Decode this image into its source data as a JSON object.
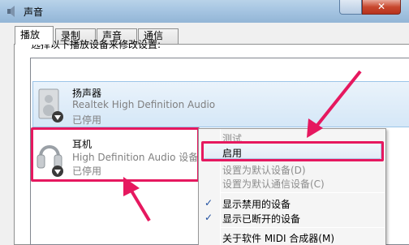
{
  "window": {
    "title": "声音",
    "close_glyph": "✕"
  },
  "tabs": [
    {
      "label": "播放",
      "active": true
    },
    {
      "label": "录制",
      "active": false
    },
    {
      "label": "声音",
      "active": false
    },
    {
      "label": "通信",
      "active": false
    }
  ],
  "instruction": "选择以下播放设备来修改设置:",
  "devices": [
    {
      "name": "扬声器",
      "description": "Realtek High Definition Audio",
      "state": "已停用",
      "icon": "speaker-icon"
    },
    {
      "name": "耳机",
      "description": "High Definition Audio 设备",
      "state": "已停用",
      "icon": "headphones-icon"
    }
  ],
  "context_menu": {
    "items": [
      {
        "label": "测试",
        "disabled": true
      },
      {
        "label": "启用",
        "disabled": false,
        "hovered": true
      },
      {
        "label": "设置为默认设备(D)",
        "disabled": true
      },
      {
        "label": "设置为默认通信设备(C)",
        "disabled": true
      },
      {
        "label": "显示禁用的设备",
        "checked": true
      },
      {
        "label": "显示已断开的设备",
        "checked": true
      },
      {
        "label": "关于软件 MIDI 合成器(M)",
        "disabled": false
      }
    ],
    "check_glyph": "✓"
  },
  "colors": {
    "annotation": "#e6185f",
    "selection": "#d5e7f7"
  }
}
